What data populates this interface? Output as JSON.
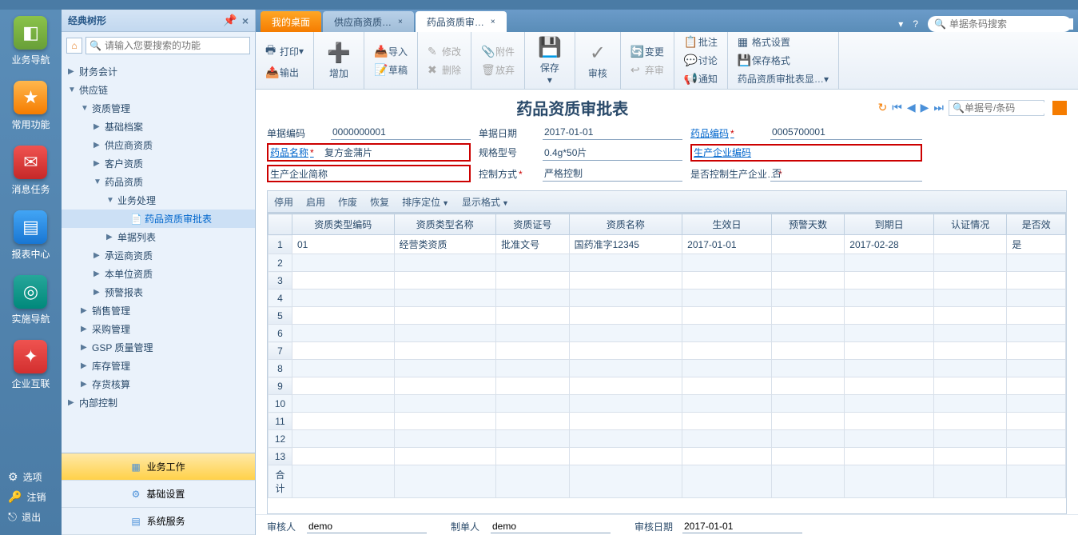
{
  "leftRail": {
    "items": [
      {
        "label": "业务导航",
        "icon": "◧"
      },
      {
        "label": "常用功能",
        "icon": "★"
      },
      {
        "label": "消息任务",
        "icon": "✉"
      },
      {
        "label": "报表中心",
        "icon": "▤"
      },
      {
        "label": "实施导航",
        "icon": "◎"
      },
      {
        "label": "企业互联",
        "icon": "✦"
      }
    ],
    "bottom": [
      {
        "label": "选项",
        "icon": "⚙"
      },
      {
        "label": "注销",
        "icon": "🔑"
      },
      {
        "label": "退出",
        "icon": "⎋"
      }
    ]
  },
  "treePanel": {
    "title": "经典树形",
    "searchPlaceholder": "请输入您要搜索的功能",
    "nodes": [
      {
        "level": 0,
        "caret": "▶",
        "label": "财务会计"
      },
      {
        "level": 0,
        "caret": "▼",
        "label": "供应链"
      },
      {
        "level": 1,
        "caret": "▼",
        "label": "资质管理"
      },
      {
        "level": 2,
        "caret": "▶",
        "label": "基础档案"
      },
      {
        "level": 2,
        "caret": "▶",
        "label": "供应商资质"
      },
      {
        "level": 2,
        "caret": "▶",
        "label": "客户资质"
      },
      {
        "level": 2,
        "caret": "▼",
        "label": "药品资质"
      },
      {
        "level": 3,
        "caret": "▼",
        "label": "业务处理"
      },
      {
        "level": 4,
        "caret": "",
        "label": "药品资质审批表",
        "selected": true,
        "doc": true
      },
      {
        "level": 3,
        "caret": "▶",
        "label": "单据列表"
      },
      {
        "level": 2,
        "caret": "▶",
        "label": "承运商资质"
      },
      {
        "level": 2,
        "caret": "▶",
        "label": "本单位资质"
      },
      {
        "level": 2,
        "caret": "▶",
        "label": "预警报表"
      },
      {
        "level": 1,
        "caret": "▶",
        "label": "销售管理"
      },
      {
        "level": 1,
        "caret": "▶",
        "label": "采购管理"
      },
      {
        "level": 1,
        "caret": "▶",
        "label": "GSP 质量管理"
      },
      {
        "level": 1,
        "caret": "▶",
        "label": "库存管理"
      },
      {
        "level": 1,
        "caret": "▶",
        "label": "存货核算"
      },
      {
        "level": 0,
        "caret": "▶",
        "label": "内部控制"
      }
    ],
    "bottom": [
      {
        "label": "业务工作",
        "active": true
      },
      {
        "label": "基础设置"
      },
      {
        "label": "系统服务"
      }
    ]
  },
  "tabs": {
    "items": [
      {
        "label": "我的桌面",
        "type": "home"
      },
      {
        "label": "供应商资质…",
        "type": "inactive"
      },
      {
        "label": "药品资质审…",
        "type": "active"
      }
    ],
    "globalSearchPlaceholder": "单据条码搜索"
  },
  "toolbar": {
    "print": "打印",
    "output": "输出",
    "add": "增加",
    "importBtn": "导入",
    "draft": "草稿",
    "modify": "修改",
    "delete": "删除",
    "attach": "附件",
    "abandon": "放弃",
    "save": "保存",
    "audit": "审核",
    "note": "批注",
    "discuss": "讨论",
    "notify": "通知",
    "change": "变更",
    "discard": "弃审",
    "formatSet": "格式设置",
    "saveFormat": "保存格式",
    "showFormat": "药品资质审批表显…"
  },
  "form": {
    "title": "药品资质审批表",
    "docSearchPlaceholder": "单据号/条码",
    "fields": {
      "billNo": {
        "label": "单据编码",
        "value": "0000000001"
      },
      "billDate": {
        "label": "单据日期",
        "value": "2017-01-01"
      },
      "drugCode": {
        "label": "药品编码",
        "value": "0005700001",
        "u": true
      },
      "drugName": {
        "label": "药品名称",
        "value": "复方金蒲片",
        "u": true,
        "hl": true
      },
      "spec": {
        "label": "规格型号",
        "value": "0.4g*50片"
      },
      "mfrCode": {
        "label": "生产企业编码",
        "value": "",
        "u": true,
        "hl": true
      },
      "mfrName": {
        "label": "生产企业简称",
        "value": "",
        "hl": true
      },
      "ctrlMode": {
        "label": "控制方式",
        "value": "严格控制"
      },
      "ctrlMfr": {
        "label": "是否控制生产企业…",
        "value": "否"
      }
    }
  },
  "subToolbar": {
    "items": [
      "停用",
      "启用",
      "作废",
      "恢复",
      "排序定位",
      "显示格式"
    ]
  },
  "grid": {
    "headers": [
      "",
      "资质类型编码",
      "资质类型名称",
      "资质证号",
      "资质名称",
      "生效日",
      "预警天数",
      "到期日",
      "认证情况",
      "是否效"
    ],
    "rows": [
      {
        "n": "1",
        "c1": "01",
        "c2": "经营类资质",
        "c3": "批准文号",
        "c4": "国药准字12345",
        "c5": "2017-01-01",
        "c6": "",
        "c7": "2017-02-28",
        "c8": "",
        "c9": "是"
      }
    ],
    "emptyRows": [
      "2",
      "3",
      "4",
      "5",
      "6",
      "7",
      "8",
      "9",
      "10",
      "11",
      "12",
      "13"
    ],
    "sumLabel": "合计"
  },
  "footer": {
    "reviewer": {
      "label": "审核人",
      "value": "demo"
    },
    "maker": {
      "label": "制单人",
      "value": "demo"
    },
    "reviewDate": {
      "label": "审核日期",
      "value": "2017-01-01"
    }
  }
}
